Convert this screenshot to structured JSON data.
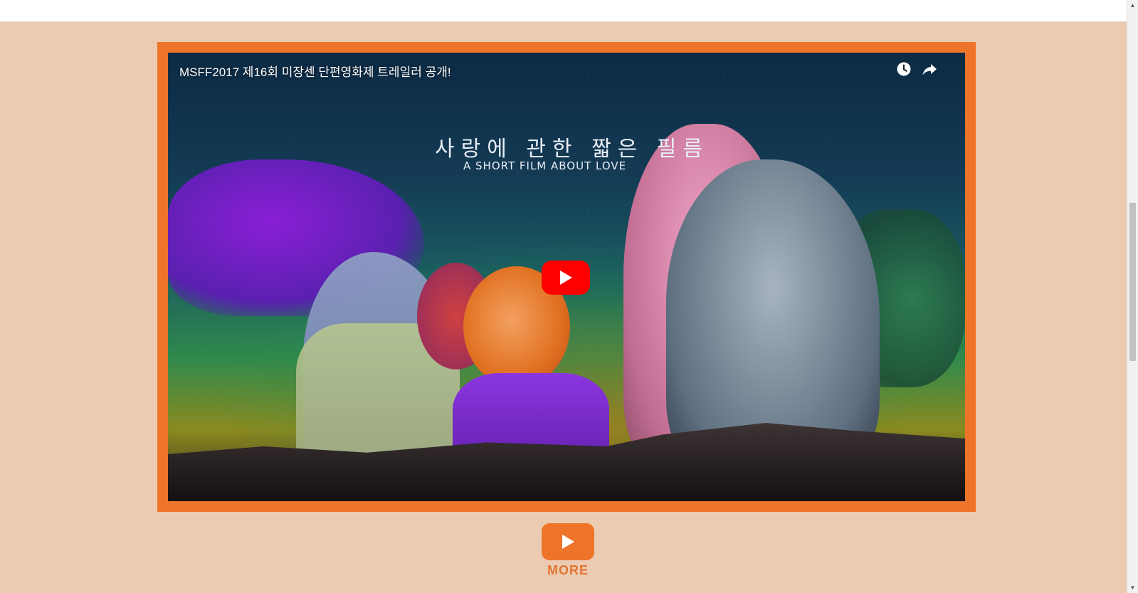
{
  "video": {
    "title": "MSFF2017 제16회 미장센 단편영화제 트레일러 공개!",
    "film_title_kr": "사랑에 관한 짧은 필름",
    "film_title_en": "A SHORT FILM ABOUT LOVE",
    "icons": {
      "watch_later": "clock-icon",
      "share": "share-icon",
      "play": "play-icon"
    }
  },
  "more": {
    "label": "MORE",
    "icon": "play-icon"
  },
  "colors": {
    "page_background": "#eccbb3",
    "frame_accent": "#ee7429",
    "youtube_red": "#ff0000",
    "more_label": "#e27530"
  }
}
